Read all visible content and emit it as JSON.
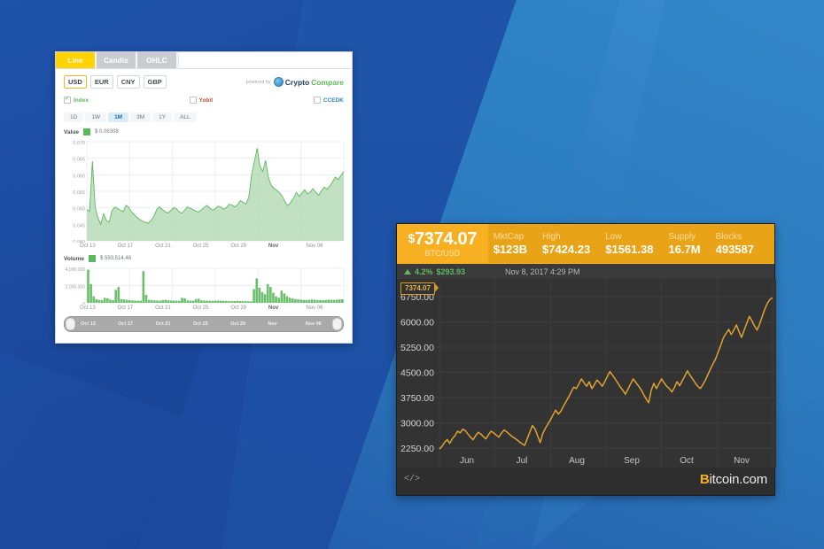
{
  "desktop": {
    "name": "windows-desktop-blue-wallpaper"
  },
  "cryptocompare_window": {
    "tabs": [
      {
        "label": "Line",
        "active": true
      },
      {
        "label": "Candle",
        "active": false
      },
      {
        "label": "OHLC",
        "active": false
      }
    ],
    "currencies": [
      {
        "label": "USD",
        "active": true
      },
      {
        "label": "EUR",
        "active": false
      },
      {
        "label": "CNY",
        "active": false
      },
      {
        "label": "GBP",
        "active": false
      }
    ],
    "powered_by_text": "powered by",
    "logo": {
      "part1": "Crypto",
      "part2": "Compare"
    },
    "exchanges": [
      {
        "label": "Index",
        "checked": true
      },
      {
        "label": "Yobit",
        "checked": false
      },
      {
        "label": "CCEDK",
        "checked": false
      }
    ],
    "ranges": [
      {
        "label": "1D",
        "active": false
      },
      {
        "label": "1W",
        "active": false
      },
      {
        "label": "1M",
        "active": true
      },
      {
        "label": "3M",
        "active": false
      },
      {
        "label": "1Y",
        "active": false
      },
      {
        "label": "ALL",
        "active": false
      }
    ],
    "value_legend": {
      "label": "Value",
      "value": "$ 0.06308",
      "color": "#5cb85c"
    },
    "volume_legend": {
      "label": "Volume",
      "value": "$ 593,514.46",
      "color": "#5cb85c"
    }
  },
  "btc_widget": {
    "price": "7374.07",
    "price_symbol": "$",
    "pair": "BTC/USD",
    "stats": [
      {
        "key": "MktCap",
        "value": "$123B"
      },
      {
        "key": "High",
        "value": "$7424.23"
      },
      {
        "key": "Low",
        "value": "$1561.38"
      },
      {
        "key": "Supply",
        "value": "16.7M"
      },
      {
        "key": "Blocks",
        "value": "493587"
      }
    ],
    "change_percent": "4.2%",
    "change_value": "$293.93",
    "timestamp": "Nov 8, 2017 4:29 PM",
    "price_tag": "7374.07",
    "code_icon_label": "</>",
    "brand_first": "B",
    "brand_rest": "itcoin.com",
    "accent_color": "#f7b022",
    "up_color": "#62b862"
  },
  "chart_data": [
    {
      "type": "area",
      "title": "Value",
      "id": "cryptocompare-value-chart",
      "ylabel": "",
      "xlabel": "",
      "ylim": [
        0.04,
        0.073
      ],
      "yticks": [
        "0.070",
        "0.065",
        "0.060",
        "0.055",
        "0.050",
        "0.045",
        "0.040"
      ],
      "xticks": [
        "Oct 13",
        "Oct 17",
        "Oct 21",
        "Oct 25",
        "Oct 29",
        "Nov",
        "Nov 06"
      ],
      "grid": true,
      "legend": "Value $ 0.06308",
      "series_color": "#5cb85c",
      "values": [
        0.0505,
        0.0498,
        0.0665,
        0.0512,
        0.0476,
        0.0455,
        0.049,
        0.0468,
        0.0462,
        0.05,
        0.0513,
        0.0508,
        0.0502,
        0.0497,
        0.0518,
        0.0512,
        0.0497,
        0.0487,
        0.0478,
        0.047,
        0.0466,
        0.0461,
        0.0459,
        0.0468,
        0.0481,
        0.0504,
        0.0513,
        0.0505,
        0.0497,
        0.0493,
        0.05,
        0.051,
        0.0508,
        0.0497,
        0.0492,
        0.0502,
        0.0513,
        0.0509,
        0.0504,
        0.0499,
        0.0496,
        0.0503,
        0.0511,
        0.0518,
        0.0509,
        0.0502,
        0.0507,
        0.0516,
        0.0512,
        0.0505,
        0.0511,
        0.0522,
        0.0519,
        0.0513,
        0.0521,
        0.0534,
        0.0528,
        0.0522,
        0.0546,
        0.062,
        0.0665,
        0.0708,
        0.0648,
        0.0631,
        0.0668,
        0.0612,
        0.0585,
        0.0575,
        0.0568,
        0.056,
        0.0548,
        0.053,
        0.0517,
        0.0528,
        0.0542,
        0.0561,
        0.0548,
        0.0559,
        0.057,
        0.0556,
        0.0562,
        0.0574,
        0.0561,
        0.0552,
        0.0566,
        0.0579,
        0.0572,
        0.0582,
        0.0597,
        0.0612,
        0.0604,
        0.0618,
        0.0631
      ]
    },
    {
      "type": "bar",
      "title": "Volume",
      "id": "cryptocompare-volume-chart",
      "ylabel": "",
      "xlabel": "",
      "ylim": [
        0,
        4800000
      ],
      "yticks": [
        "4,000,000",
        "2,000,000",
        "0"
      ],
      "xticks": [
        "Oct 13",
        "Oct 17",
        "Oct 21",
        "Oct 25",
        "Oct 29",
        "Nov",
        "Nov 06"
      ],
      "grid": true,
      "legend": "Volume $ 593,514.46",
      "series_color": "#5cb85c",
      "values": [
        4600000,
        2600000,
        900000,
        500000,
        420000,
        380000,
        700000,
        620000,
        450000,
        380000,
        1800000,
        2200000,
        520000,
        480000,
        420000,
        360000,
        330000,
        300000,
        290000,
        310000,
        4400000,
        1100000,
        420000,
        380000,
        340000,
        320000,
        300000,
        380000,
        420000,
        360000,
        330000,
        310000,
        290000,
        300000,
        700000,
        620000,
        340000,
        310000,
        300000,
        520000,
        560000,
        340000,
        320000,
        300000,
        290000,
        280000,
        300000,
        320000,
        300000,
        280000,
        260000,
        240000,
        230000,
        250000,
        270000,
        250000,
        230000,
        220000,
        210000,
        200000,
        1900000,
        3400000,
        2100000,
        1500000,
        1200000,
        2600000,
        2200000,
        1400000,
        900000,
        700000,
        1700000,
        1300000,
        900000,
        700000,
        600000,
        520000,
        480000,
        440000,
        400000,
        380000,
        420000,
        460000,
        440000,
        400000,
        380000,
        360000,
        400000,
        440000,
        420000,
        400000,
        430000,
        470000,
        500000
      ]
    },
    {
      "type": "line",
      "title": "BTC/USD",
      "id": "bitcoin-com-price-chart",
      "ylabel": "",
      "xlabel": "",
      "ylim": [
        1900,
        7600
      ],
      "yticks": [
        "6750.00",
        "6000.00",
        "5250.00",
        "4500.00",
        "3750.00",
        "3000.00",
        "2250.00"
      ],
      "xticks": [
        "Jun",
        "Jul",
        "Aug",
        "Sep",
        "Oct",
        "Nov"
      ],
      "grid": true,
      "series_color": "#e0a32e",
      "values": [
        2050,
        2150,
        2290,
        2380,
        2250,
        2420,
        2520,
        2680,
        2620,
        2750,
        2700,
        2580,
        2470,
        2380,
        2520,
        2640,
        2580,
        2490,
        2410,
        2560,
        2680,
        2620,
        2540,
        2470,
        2610,
        2720,
        2660,
        2580,
        2500,
        2440,
        2380,
        2300,
        2240,
        2180,
        2420,
        2650,
        2880,
        2760,
        2520,
        2280,
        2600,
        2780,
        2930,
        3080,
        3260,
        3420,
        3280,
        3380,
        3560,
        3720,
        3880,
        4060,
        4230,
        4180,
        4350,
        4520,
        4380,
        4260,
        4420,
        4180,
        4320,
        4480,
        4380,
        4260,
        4420,
        4600,
        4780,
        4650,
        4520,
        4380,
        4240,
        4120,
        3980,
        4160,
        4340,
        4520,
        4400,
        4280,
        4150,
        3980,
        3820,
        3680,
        4120,
        4360,
        4180,
        4350,
        4520,
        4380,
        4260,
        4180,
        4060,
        4220,
        4420,
        4280,
        4450,
        4620,
        4800,
        4650,
        4520,
        4380,
        4260,
        4180,
        4320,
        4480,
        4680,
        4880,
        5060,
        5240,
        5480,
        5720,
        5980,
        6120,
        6260,
        6080,
        6240,
        6420,
        6180,
        5980,
        6240,
        6480,
        6720,
        6560,
        6380,
        6240,
        6460,
        6720,
        6980,
        7180,
        7320,
        7374
      ]
    }
  ]
}
